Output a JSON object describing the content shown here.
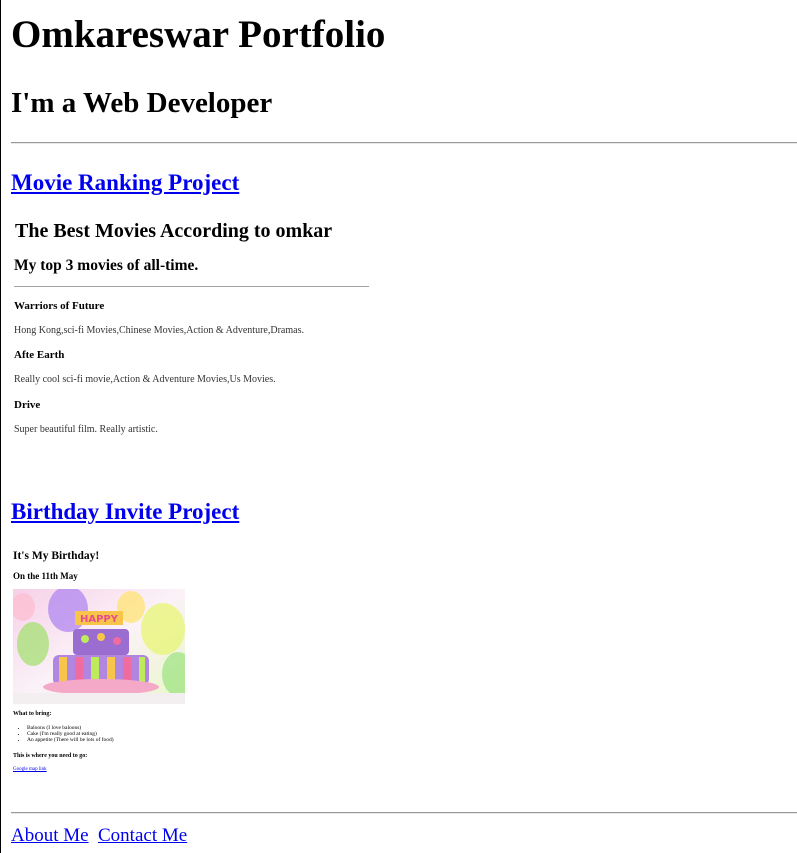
{
  "header": {
    "title": "Omkareswar Portfolio",
    "subtitle": "I'm a Web Developer"
  },
  "projects": {
    "movie": {
      "link_label": "Movie Ranking Project",
      "heading": "The Best Movies According to omkar",
      "subheading": "My top 3 movies of all-time.",
      "movies": [
        {
          "title": "Warriors of Future",
          "description": "Hong Kong,sci-fi Movies,Chinese Movies,Action & Adventure,Dramas."
        },
        {
          "title": "Afte Earth",
          "description": "Really cool sci-fi movie,Action & Adventure Movies,Us Movies."
        },
        {
          "title": "Drive",
          "description": "Super beautiful film. Really artistic."
        }
      ]
    },
    "birthday": {
      "link_label": "Birthday Invite Project",
      "heading": "It's My Birthday!",
      "date": "On the 11th May",
      "bring_label": "What to bring:",
      "bring_items": [
        "Baloons (I love baloons)",
        "Cake (I'm really good at eating)",
        "An appetite (There will be lots of food)"
      ],
      "where_label": "This is where you need to go:",
      "map_link": "Google map link",
      "image_icon": "birthday-cake-image"
    }
  },
  "footer": {
    "about_label": "About Me",
    "contact_label": "Contact Me"
  },
  "colors": {
    "link": "#0000ee",
    "text": "#000000",
    "rule": "#9a9a9a"
  }
}
